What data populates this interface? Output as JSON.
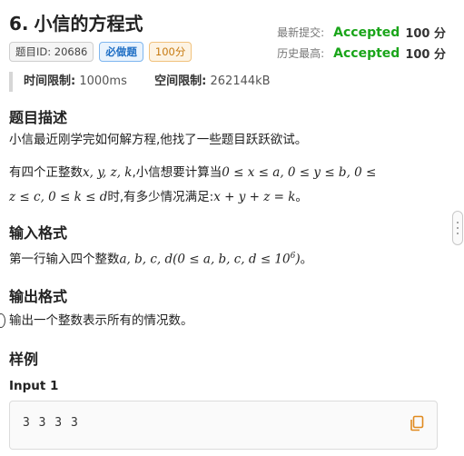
{
  "problem": {
    "number": "6.",
    "title": "小信的方程式",
    "id_tag": "题目ID: 20686",
    "required_tag": "必做题",
    "points_tag": "100分"
  },
  "status": {
    "latest_label": "最新提交:",
    "latest_result": "Accepted",
    "latest_score": "100 分",
    "best_label": "历史最高:",
    "best_result": "Accepted",
    "best_score": "100 分"
  },
  "limits": {
    "time_label": "时间限制:",
    "time_value": "1000ms",
    "memory_label": "空间限制:",
    "memory_value": "262144kB"
  },
  "description": {
    "heading": "题目描述",
    "intro": "小信最近刚学完如何解方程,他找了一些题目跃跃欲试。",
    "p2_part1": "有四个正整数",
    "p2_math1": "x, y, z, k",
    "p2_part2": ",小信想要计算当",
    "p2_math2": "0 ≤ x ≤ a, 0 ≤ y ≤ b, 0 ≤",
    "p2_math3": "z ≤ c, 0 ≤ k ≤ d",
    "p2_part3": "时,有多少情况满足:",
    "p2_math4": "x + y + z = k",
    "p2_part4": "。"
  },
  "input_format": {
    "heading": "输入格式",
    "part1": "第一行输入四个整数",
    "math1": "a, b, c, d(0 ≤ a, b, c, d ≤ 10",
    "sup": "6",
    "math2": ")",
    "part2": "。"
  },
  "output_format": {
    "heading": "输出格式",
    "text": "输出一个整数表示所有的情况数。"
  },
  "samples": {
    "heading": "样例",
    "input_label": "Input 1",
    "input_value": "3 3 3 3"
  }
}
